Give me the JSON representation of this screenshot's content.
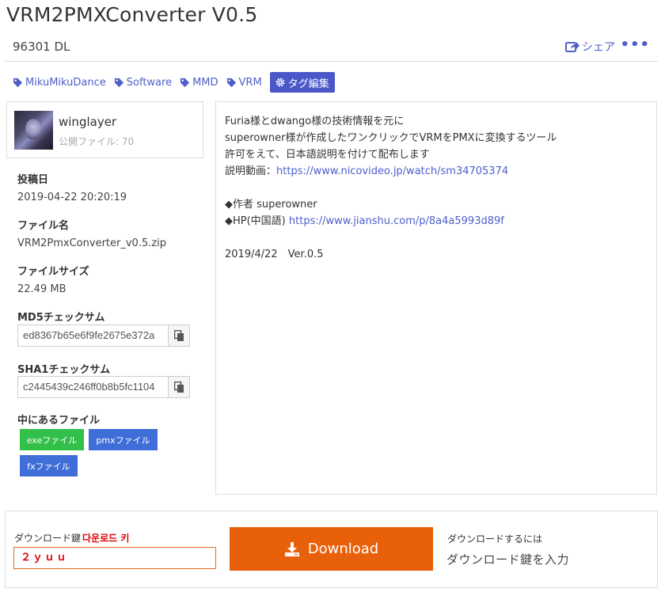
{
  "page": {
    "title": "VRM2PMXConverter V0.5"
  },
  "stats": {
    "downloads": "96301 DL",
    "share_label": "シェア",
    "more_label": "•••"
  },
  "tags": {
    "items": [
      {
        "label": "MikuMikuDance"
      },
      {
        "label": "Software"
      },
      {
        "label": "MMD"
      },
      {
        "label": "VRM"
      }
    ],
    "edit_label": "タグ編集"
  },
  "author": {
    "name": "winglayer",
    "files": "公開ファイル: 70"
  },
  "meta": {
    "posted_label": "投稿日",
    "posted_value": "2019-04-22 20:20:19",
    "filename_label": "ファイル名",
    "filename_value": "VRM2PmxConverter_v0.5.zip",
    "filesize_label": "ファイルサイズ",
    "filesize_value": "22.49 MB",
    "md5_label": "MD5チェックサム",
    "md5_value": "ed8367b65e6f9fe2675e372a",
    "sha1_label": "SHA1チェックサム",
    "sha1_value": "c2445439c246ff0b8b5fc1104",
    "contents_label": "中にあるファイル",
    "file_buttons": [
      "exeファイル",
      "pmxファイル",
      "fxファイル"
    ]
  },
  "description": {
    "line1": "Furia様とdwango様の技術情報を元に",
    "line2": "superowner様が作成したワンクリックでVRMをPMXに変換するツール",
    "line3": "許可をえて、日本語説明を付けて配布します",
    "line4_prefix": "説明動画：",
    "line4_link": "https://www.nicovideo.jp/watch/sm34705374",
    "line6": "◆作者 superowner",
    "line7_prefix": "◆HP(中国語) ",
    "line7_link": "https://www.jianshu.com/p/8a4a5993d89f",
    "line9": "2019/4/22　Ver.0.5"
  },
  "download": {
    "key_label": "ダウンロード鍵",
    "key_label_ko": "다운로드 키",
    "key_value": "２ｙｕｕ",
    "button_label": "Download",
    "howto_title": "ダウンロードするには",
    "howto_text": "ダウンロード鍵を入力"
  },
  "colors": {
    "accent": "#4e5fc9",
    "tag_edit_bg": "#4a57c8",
    "download_button": "#e8610a",
    "exe_button": "#33c04a",
    "pmx_button": "#3f6ed8",
    "fx_button": "#3f6ed8",
    "key_text": "#e00000"
  }
}
